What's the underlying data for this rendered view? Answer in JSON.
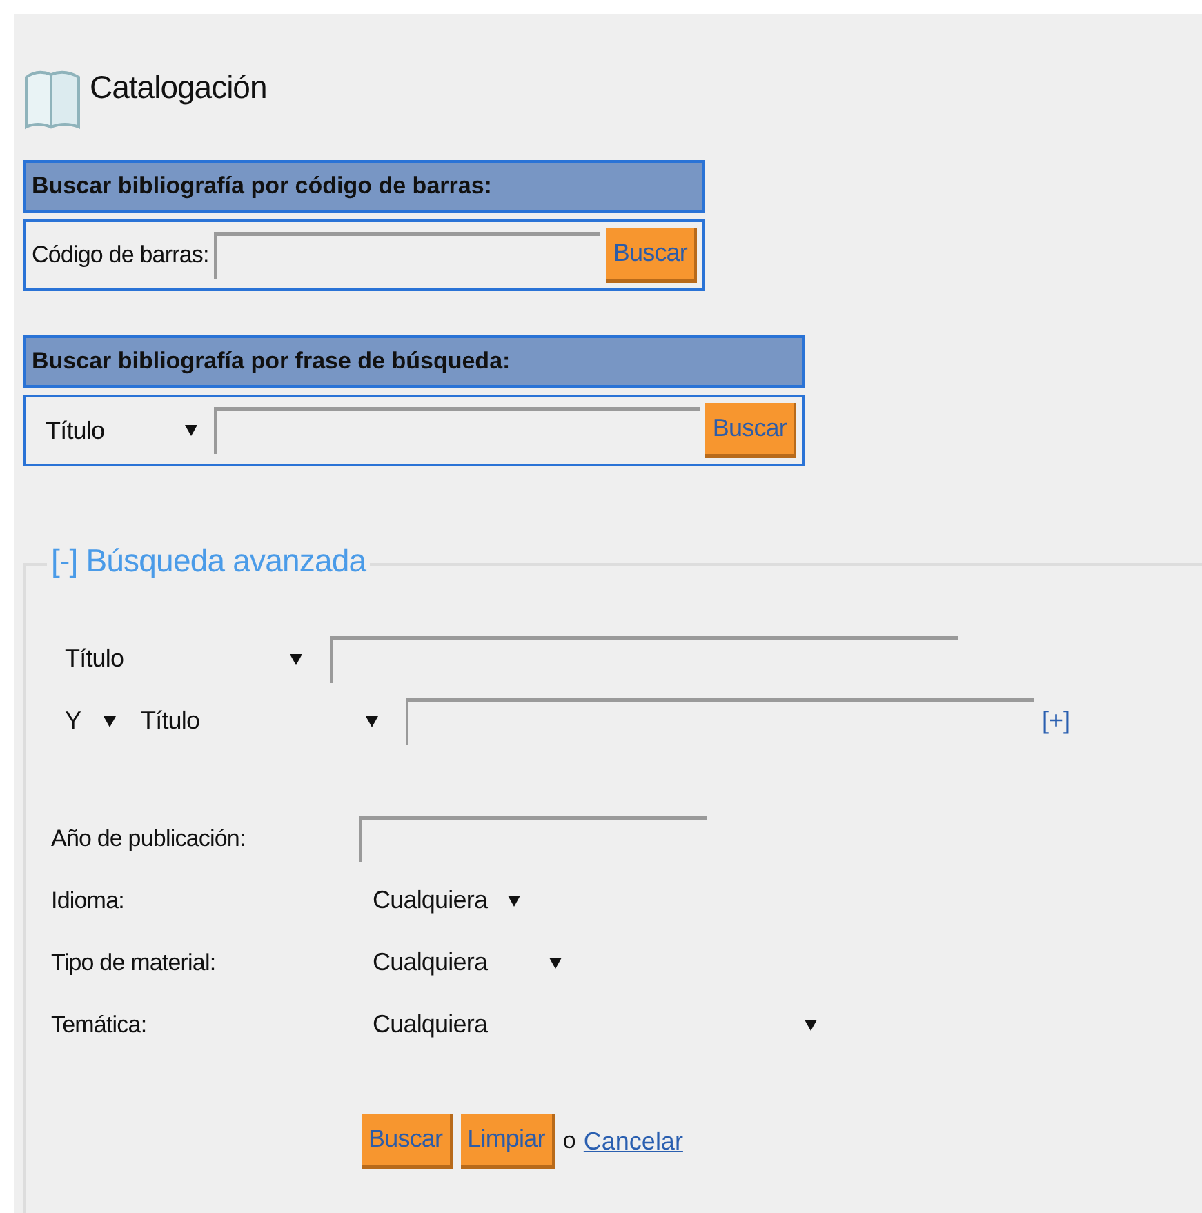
{
  "page": {
    "title": "Catalogación"
  },
  "barcode_search": {
    "heading": "Buscar bibliografía por código de barras:",
    "label": "Código de barras:",
    "button": "Buscar"
  },
  "phrase_search": {
    "heading": "Buscar bibliografía por frase de búsqueda:",
    "field": "Título",
    "button": "Buscar"
  },
  "advanced": {
    "legend": "[-] Búsqueda avanzada",
    "criteria": [
      {
        "field": "Título"
      },
      {
        "operator": "Y",
        "field": "Título"
      }
    ],
    "add_link": "[+]",
    "filters": [
      {
        "kind": "input",
        "label": "Año de publicación:"
      },
      {
        "kind": "select",
        "label": "Idioma:",
        "value": "Cualquiera"
      },
      {
        "kind": "select",
        "label": "Tipo de material:",
        "value": "Cualquiera"
      },
      {
        "kind": "select",
        "label": "Temática:",
        "value": "Cualquiera"
      }
    ],
    "buttons": [
      "Buscar",
      "Limpiar"
    ],
    "separator": "o",
    "cancel_link": "Cancelar"
  }
}
